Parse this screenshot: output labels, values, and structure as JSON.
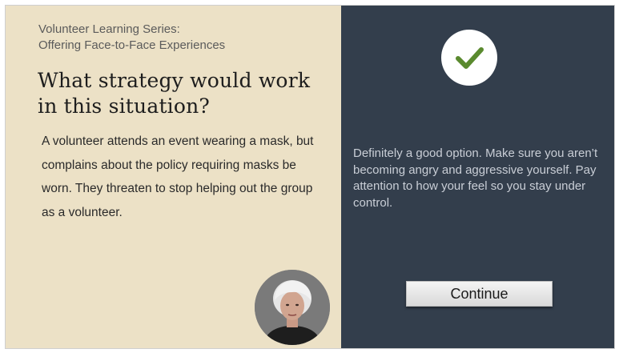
{
  "slide": {
    "series_title": "Volunteer Learning Series:\nOffering Face-to-Face Experiences",
    "question": "What strategy would work in this situation?",
    "scenario": "A volunteer attends an event wearing a mask, but complains about the policy requiring masks be worn. They threaten to stop helping out the group as a volunteer."
  },
  "feedback": {
    "icon": "checkmark-icon",
    "text": "Definitely a good option.  Make sure you aren’t becoming angry and aggressive yourself.  Pay attention to how your feel so you stay under control."
  },
  "actions": {
    "continue_label": "Continue"
  },
  "colors": {
    "left_background": "#ece1c6",
    "right_background": "#333e4c",
    "check_color": "#5a8a2e"
  }
}
